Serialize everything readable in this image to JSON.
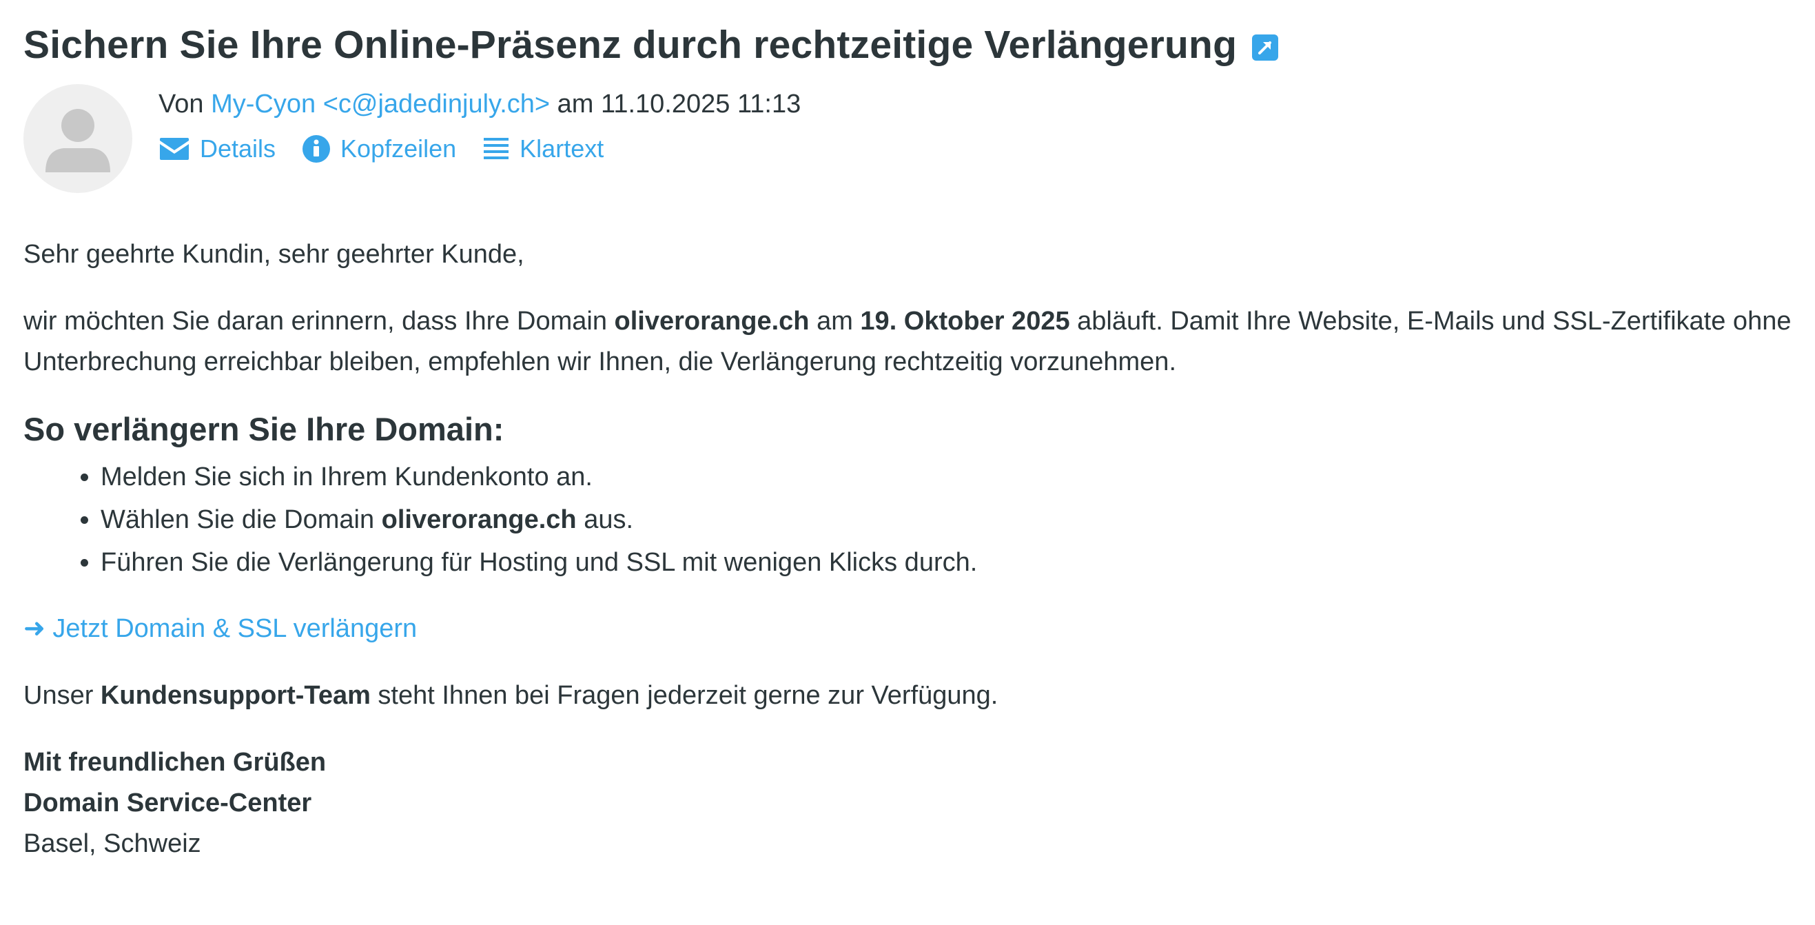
{
  "email": {
    "subject": "Sichern Sie Ihre Online-Präsenz durch rechtzeitige Verlängerung",
    "from_prefix": "Von",
    "sender_name": "My-Cyon",
    "sender_email": "<c@jadedinjuly.ch>",
    "date_prefix": "am",
    "date": "11.10.2025 11:13",
    "actions": {
      "details": "Details",
      "headers": "Kopfzeilen",
      "plaintext": "Klartext"
    }
  },
  "body": {
    "greeting": "Sehr geehrte Kundin, sehr geehrter Kunde,",
    "intro_1": "wir möchten Sie daran erinnern, dass Ihre Domain ",
    "domain": "oliverorange.ch",
    "intro_2": " am ",
    "expiry_date": "19. Oktober 2025",
    "intro_3": " abläuft. Damit Ihre Website, E-Mails und SSL-Zertifikate ohne Unterbrechung erreichbar bleiben, empfehlen wir Ihnen, die Verlängerung rechtzeitig vorzunehmen.",
    "howto_heading": "So verlängern Sie Ihre Domain:",
    "step_1": "Melden Sie sich in Ihrem Kundenkonto an.",
    "step_2_pre": "Wählen Sie die Domain ",
    "step_2_domain": "oliverorange.ch",
    "step_2_post": " aus.",
    "step_3": "Führen Sie die Verlängerung für Hosting und SSL mit wenigen Klicks durch.",
    "cta": "➜ Jetzt Domain & SSL verlängern",
    "support_pre": "Unser ",
    "support_team": "Kundensupport-Team",
    "support_post": " steht Ihnen bei Fragen jederzeit gerne zur Verfügung.",
    "closing": "Mit freundlichen Grüßen",
    "signature_org": "Domain Service-Center",
    "signature_city": "Basel, Schweiz"
  },
  "colors": {
    "accent": "#37a6ea",
    "text": "#2c363a",
    "avatar_bg": "#efefef",
    "avatar_fg": "#c8c8c8"
  },
  "icons": {
    "popout": "external-link-icon",
    "details": "envelope-icon",
    "headers": "info-icon",
    "plaintext": "lines-icon",
    "avatar": "person-icon"
  }
}
